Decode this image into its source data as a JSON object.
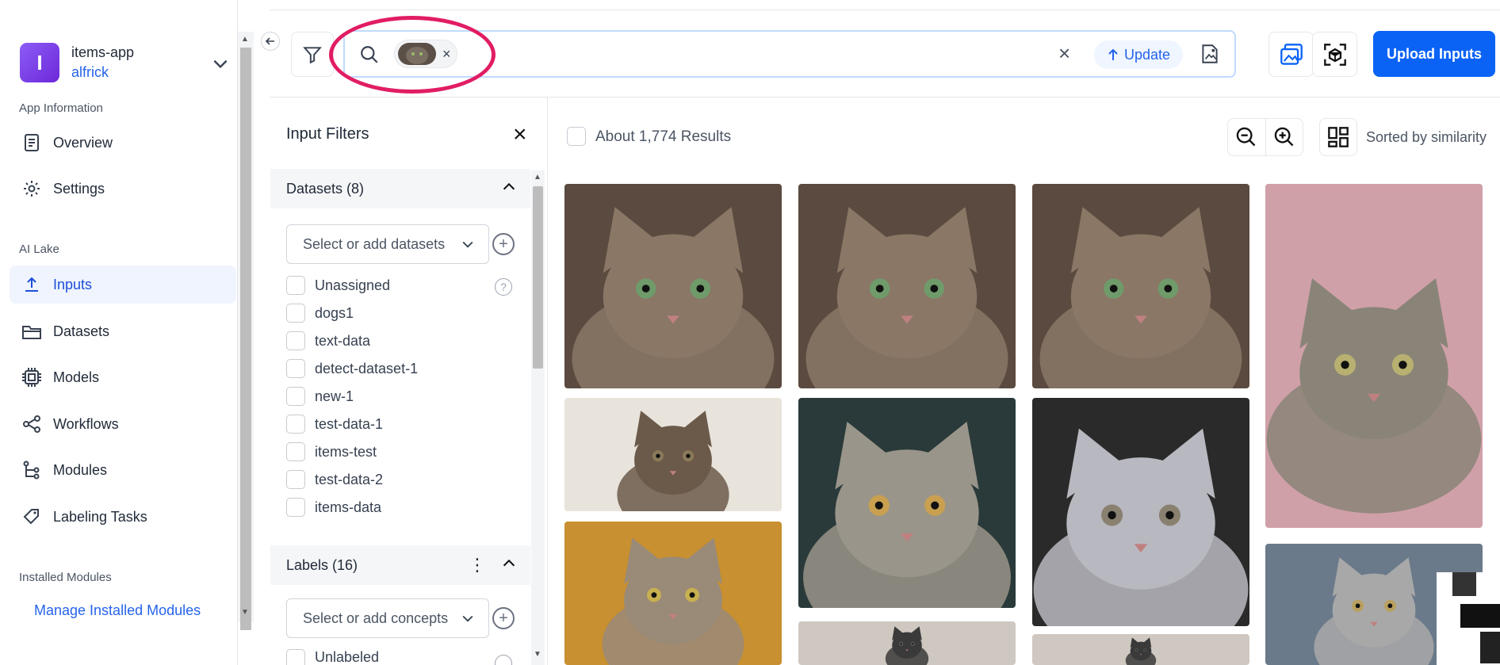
{
  "app": {
    "name": "items-app",
    "user": "alfrick",
    "avatar_letter": "I"
  },
  "sidebar": {
    "sections": {
      "app_info": "App Information",
      "ai_lake": "AI Lake",
      "installed": "Installed Modules"
    },
    "items": [
      {
        "label": "Overview",
        "icon": "document-icon"
      },
      {
        "label": "Settings",
        "icon": "gear-icon"
      },
      {
        "label": "Inputs",
        "icon": "upload-icon",
        "active": true
      },
      {
        "label": "Datasets",
        "icon": "folder-icon"
      },
      {
        "label": "Models",
        "icon": "chip-icon"
      },
      {
        "label": "Workflows",
        "icon": "share-icon"
      },
      {
        "label": "Modules",
        "icon": "tree-icon"
      },
      {
        "label": "Labeling Tasks",
        "icon": "tag-icon"
      }
    ],
    "manage_link": "Manage Installed Modules"
  },
  "search": {
    "update_label": "Update",
    "chip_icon": "cat-thumbnail"
  },
  "toolbar": {
    "upload_label": "Upload Inputs"
  },
  "filters": {
    "title": "Input Filters",
    "datasets": {
      "header": "Datasets (8)",
      "placeholder": "Select or add datasets",
      "options": [
        "Unassigned",
        "dogs1",
        "text-data",
        "detect-dataset-1",
        "new-1",
        "test-data-1",
        "items-test",
        "test-data-2",
        "items-data"
      ]
    },
    "labels": {
      "header": "Labels (16)",
      "placeholder": "Select or add concepts",
      "first_option": "Unlabeled"
    }
  },
  "results": {
    "count_label": "About 1,774 Results",
    "sort_label": "Sorted by similarity"
  },
  "colors": {
    "accent": "#0b63f6",
    "highlight": "#e11d63",
    "active_bg": "#eff4ff"
  }
}
